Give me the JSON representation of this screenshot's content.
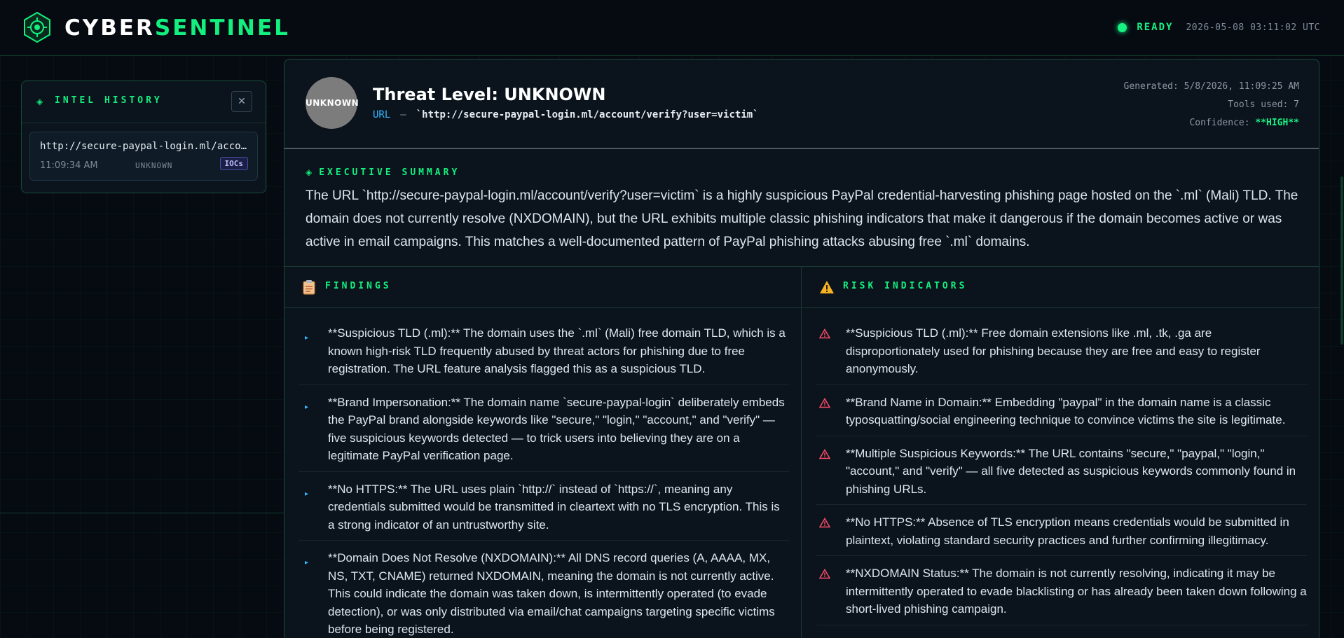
{
  "brand": {
    "part1": "CYBER",
    "part2": "SENTINEL"
  },
  "status": {
    "label": "READY",
    "timestamp": "2026-05-08 03:11:02 UTC"
  },
  "history": {
    "title": "INTEL HISTORY",
    "close_label": "✕",
    "items": [
      {
        "url": "http://secure-paypal-login.ml/account/verify?user=victim",
        "time": "11:09:34 AM",
        "level": "UNKNOWN",
        "badge": "IOCs"
      }
    ]
  },
  "report": {
    "threat_badge": "UNKNOWN",
    "title": "Threat Level: UNKNOWN",
    "url_label": "URL",
    "url_separator": "—",
    "url_value": "`http://secure-paypal-login.ml/account/verify?user=victim`",
    "generated": "Generated: 5/8/2026, 11:09:25 AM",
    "tools_used": "Tools used: 7",
    "confidence_label": "Confidence: ",
    "confidence_value": "**HIGH**",
    "summary": {
      "title": "EXECUTIVE SUMMARY",
      "text": "The URL `http://secure-paypal-login.ml/account/verify?user=victim` is a highly suspicious PayPal credential-harvesting phishing page hosted on the `.ml` (Mali) TLD. The domain does not currently resolve (NXDOMAIN), but the URL exhibits multiple classic phishing indicators that make it dangerous if the domain becomes active or was active in email campaigns. This matches a well-documented pattern of PayPal phishing attacks abusing free `.ml` domains."
    },
    "findings": {
      "title": "FINDINGS",
      "items": [
        "**Suspicious TLD (.ml):** The domain uses the `.ml` (Mali) free domain TLD, which is a known high-risk TLD frequently abused by threat actors for phishing due to free registration. The URL feature analysis flagged this as a suspicious TLD.",
        "**Brand Impersonation:** The domain name `secure-paypal-login` deliberately embeds the PayPal brand alongside keywords like \"secure,\" \"login,\" \"account,\" and \"verify\" — five suspicious keywords detected — to trick users into believing they are on a legitimate PayPal verification page.",
        "**No HTTPS:** The URL uses plain `http://` instead of `https://`, meaning any credentials submitted would be transmitted in cleartext with no TLS encryption. This is a strong indicator of an untrustworthy site.",
        "**Domain Does Not Resolve (NXDOMAIN):** All DNS record queries (A, AAAA, MX, NS, TXT, CNAME) returned NXDOMAIN, meaning the domain is not currently active. This could indicate the domain was taken down, is intermittently operated (to evade detection), or was only distributed via email/chat campaigns targeting specific victims before being registered."
      ]
    },
    "risks": {
      "title": "RISK INDICATORS",
      "items": [
        "**Suspicious TLD (.ml):** Free domain extensions like .ml, .tk, .ga are disproportionately used for phishing because they are free and easy to register anonymously.",
        "**Brand Name in Domain:** Embedding \"paypal\" in the domain name is a classic typosquatting/social engineering technique to convince victims the site is legitimate.",
        "**Multiple Suspicious Keywords:** The URL contains \"secure,\" \"paypal,\" \"login,\" \"account,\" and \"verify\" — all five detected as suspicious keywords commonly found in phishing URLs.",
        "**No HTTPS:** Absence of TLS encryption means credentials would be submitted in plaintext, violating standard security practices and further confirming illegitimacy.",
        "**NXDOMAIN Status:** The domain is not currently resolving, indicating it may be intermittently operated to evade blacklisting or has already been taken down following a short-lived phishing campaign."
      ]
    }
  },
  "colors": {
    "accent": "#13f07f",
    "link": "#33b8ff",
    "warning": "#ff4d6a",
    "badge_gray": "#7c7c7c"
  }
}
